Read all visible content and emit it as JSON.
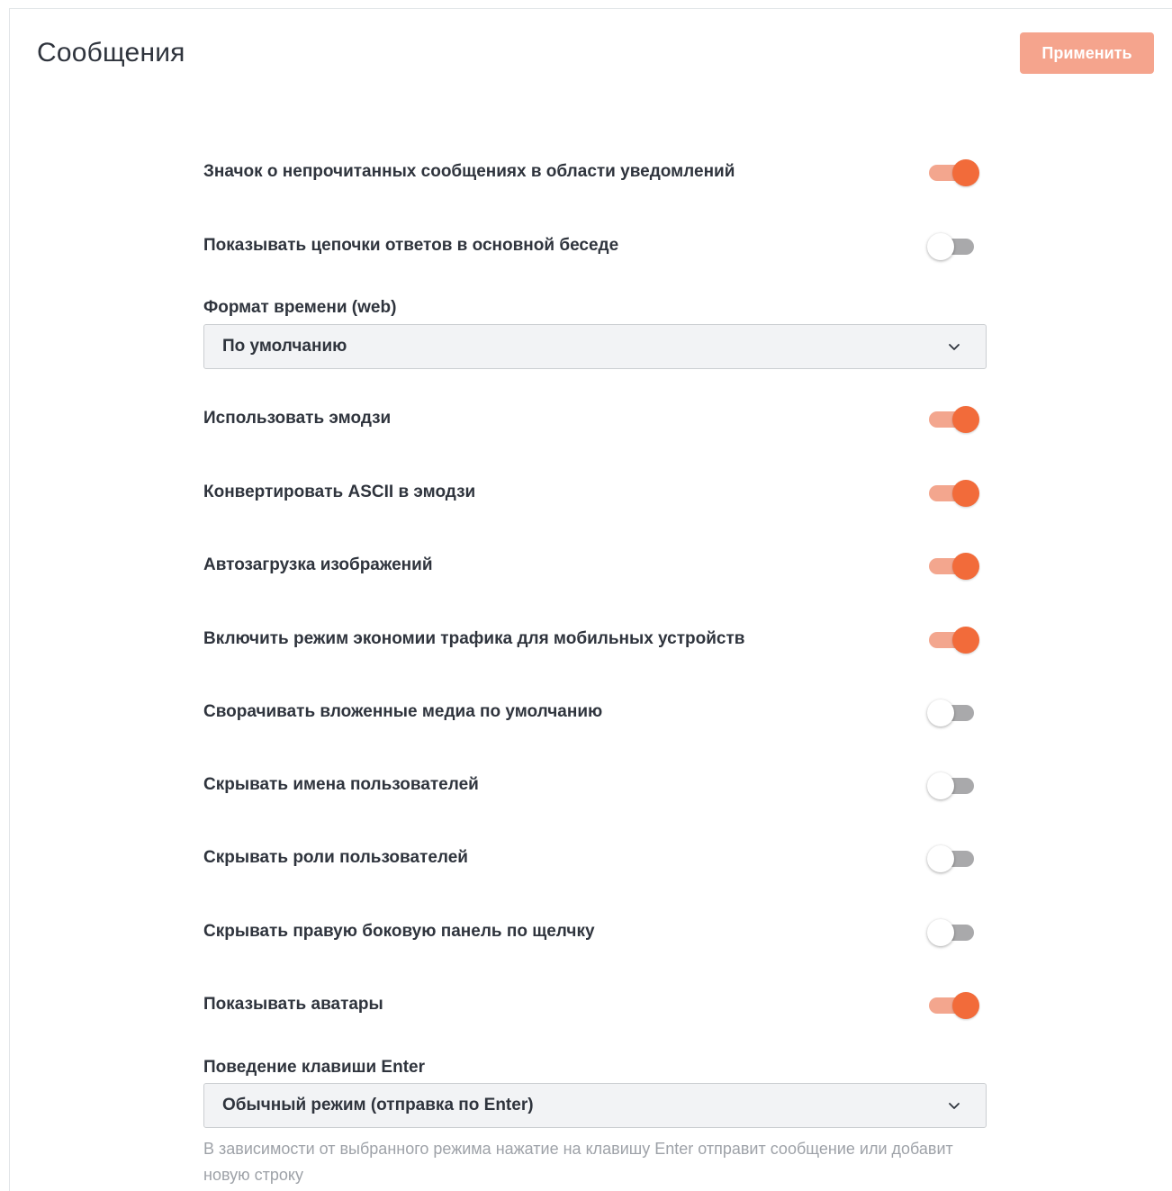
{
  "page": {
    "title": "Сообщения",
    "apply_label": "Применить"
  },
  "settings": {
    "unread_badge": {
      "label": "Значок о непрочитанных сообщениях в области уведомлений",
      "on": true
    },
    "show_threads": {
      "label": "Показывать цепочки ответов в основной беседе",
      "on": false
    },
    "time_format": {
      "label": "Формат времени (web)",
      "value": "По умолчанию"
    },
    "use_emoji": {
      "label": "Использовать эмодзи",
      "on": true
    },
    "ascii_emoji": {
      "label": "Конвертировать ASCII в эмодзи",
      "on": true
    },
    "autoload_images": {
      "label": "Автозагрузка изображений",
      "on": true
    },
    "data_saver": {
      "label": "Включить режим экономии трафика для мобильных устройств",
      "on": true
    },
    "collapse_media": {
      "label": "Сворачивать вложенные медиа по умолчанию",
      "on": false
    },
    "hide_usernames": {
      "label": "Скрывать имена пользователей",
      "on": false
    },
    "hide_roles": {
      "label": "Скрывать роли пользователей",
      "on": false
    },
    "hide_flextab": {
      "label": "Скрывать правую боковую панель по щелчку",
      "on": false
    },
    "show_avatars": {
      "label": "Показывать аватары",
      "on": true
    },
    "enter_behavior": {
      "label": "Поведение клавиши Enter",
      "value": "Обычный режим (отправка по Enter)",
      "hint": "В зависимости от выбранного режима нажатие на клавишу Enter отправит сообщение или добавит новую строку"
    }
  },
  "colors": {
    "accent": "#f26b3a",
    "accent_track": "#f3a68e",
    "apply_button": "#f5a48d",
    "toggle_off_track": "#a9a9ab"
  },
  "icons": {
    "select_chevron": "chevron-down-icon"
  }
}
